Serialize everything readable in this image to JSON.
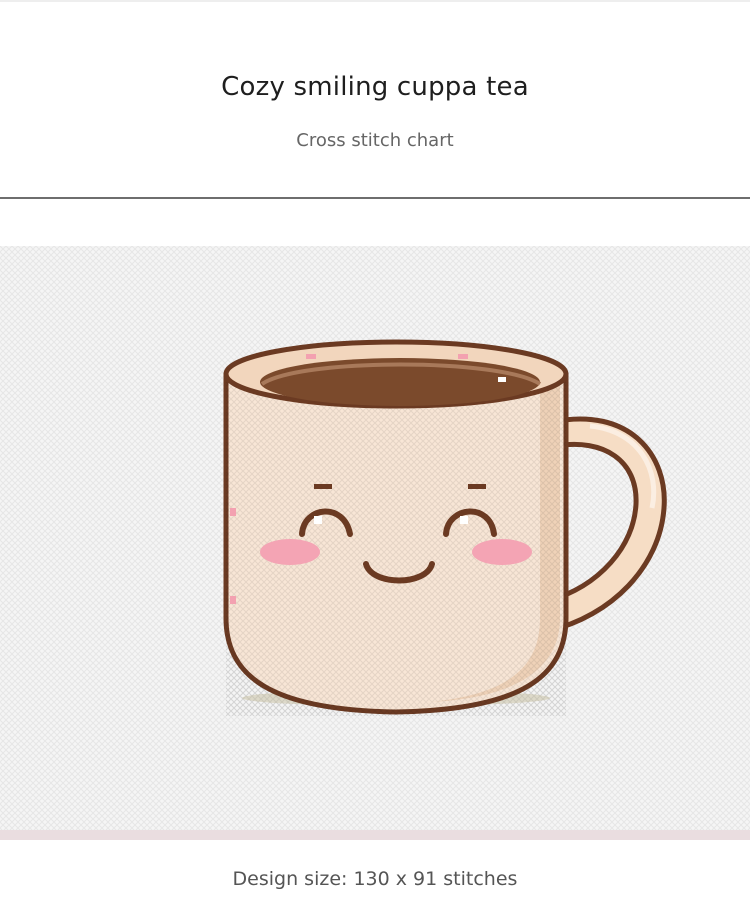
{
  "header": {
    "title": "Cozy smiling cuppa tea",
    "subtitle": "Cross stitch chart"
  },
  "footer": {
    "design_size": "Design size: 130 x 91 stitches"
  },
  "colors": {
    "fabric": "#f4f4f4",
    "outline": "#6b3a22",
    "mug_body": "#f7e3d2",
    "mug_shade": "#eac9ae",
    "tea": "#7a4a2c",
    "tea_rim": "#d8b594",
    "cheek": "#f4a7b4",
    "shadow": "#dcd8c8",
    "bottom_band": "#e8d8dc"
  },
  "illustration": {
    "icon": "smiling-tea-cup-icon"
  }
}
